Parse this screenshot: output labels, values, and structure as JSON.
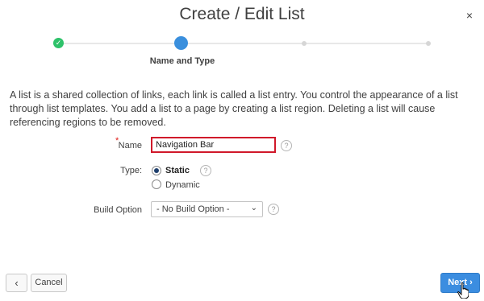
{
  "dialog": {
    "title": "Create / Edit List",
    "close_icon": "close-icon",
    "close_glyph": "×"
  },
  "wizard": {
    "steps": [
      "completed",
      "current",
      "pending",
      "pending"
    ],
    "current_label": "Name and Type",
    "done_glyph": "✓"
  },
  "description": "A list is a shared collection of links, each link is called a list entry. You control the appearance of a list through list templates. You add a list to a page by creating a list region. Deleting a list will cause referencing regions to be removed.",
  "form": {
    "name": {
      "label": "Name",
      "required_marker": "*",
      "value": "Navigation Bar",
      "help_glyph": "?"
    },
    "type": {
      "label": "Type:",
      "options": [
        {
          "label": "Static",
          "checked": true
        },
        {
          "label": "Dynamic",
          "checked": false
        }
      ],
      "help_glyph": "?"
    },
    "build_option": {
      "label": "Build Option",
      "selected": "- No Build Option -",
      "chevron_glyph": "⌄",
      "help_glyph": "?"
    }
  },
  "footer": {
    "back_glyph": "‹",
    "cancel_label": "Cancel",
    "next_label": "Next ›"
  },
  "colors": {
    "accent": "#3b8de0",
    "success": "#2ec26a",
    "error_border": "#d0182a"
  }
}
